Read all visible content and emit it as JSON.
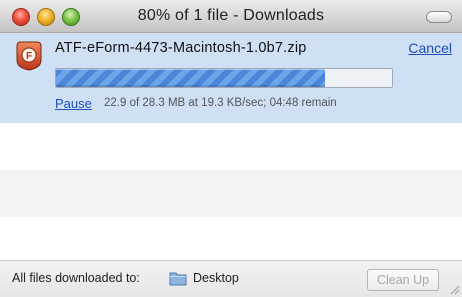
{
  "window": {
    "title": "80% of 1 file - Downloads"
  },
  "download": {
    "file_name": "ATF-eForm-4473-Macintosh-1.0b7.zip",
    "cancel_label": "Cancel",
    "pause_label": "Pause",
    "status": "22.9 of 28.3 MB at 19.3 KB/sec; 04:48 remain",
    "progress_fraction": 0.8,
    "file_icon": "zip-archive-icon"
  },
  "footer": {
    "destination_label": "All files downloaded to:",
    "folder_name": "Desktop",
    "folder_icon": "folder-icon",
    "cleanup_label": "Clean Up"
  },
  "colors": {
    "selected_row": "#cfe0f5",
    "progress": "#4b86d8",
    "link": "#1e4fb5"
  }
}
